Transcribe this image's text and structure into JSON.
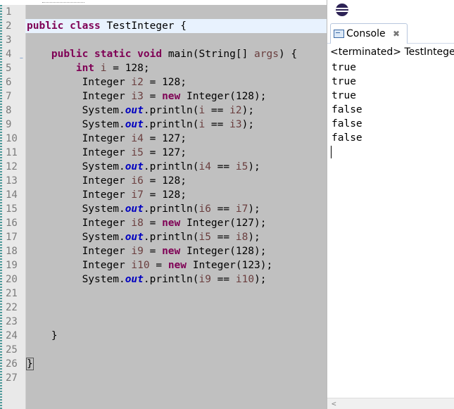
{
  "editor": {
    "lines": [
      {
        "n": "1",
        "tokens": []
      },
      {
        "n": "2",
        "tokens": [
          [
            "kw",
            "public"
          ],
          [
            "t",
            " "
          ],
          [
            "kw",
            "class"
          ],
          [
            "t",
            " TestInteger {"
          ]
        ],
        "highlight": true
      },
      {
        "n": "3",
        "tokens": []
      },
      {
        "n": "4",
        "tokens": [
          [
            "t",
            "    "
          ],
          [
            "kw",
            "public"
          ],
          [
            "t",
            " "
          ],
          [
            "kw",
            "static"
          ],
          [
            "t",
            " "
          ],
          [
            "kw",
            "void"
          ],
          [
            "t",
            " main(String[] "
          ],
          [
            "var",
            "args"
          ],
          [
            "t",
            ") {"
          ]
        ],
        "fold": true
      },
      {
        "n": "5",
        "tokens": [
          [
            "t",
            "        "
          ],
          [
            "kw",
            "int"
          ],
          [
            "t",
            " "
          ],
          [
            "var",
            "i"
          ],
          [
            "t",
            " = 128;"
          ]
        ]
      },
      {
        "n": "6",
        "tokens": [
          [
            "t",
            "         Integer "
          ],
          [
            "var",
            "i2"
          ],
          [
            "t",
            " = 128;"
          ]
        ]
      },
      {
        "n": "7",
        "tokens": [
          [
            "t",
            "         Integer "
          ],
          [
            "var",
            "i3"
          ],
          [
            "t",
            " = "
          ],
          [
            "kw",
            "new"
          ],
          [
            "t",
            " Integer(128);"
          ]
        ]
      },
      {
        "n": "8",
        "tokens": [
          [
            "t",
            "         System."
          ],
          [
            "fld",
            "out"
          ],
          [
            "t",
            ".println("
          ],
          [
            "var",
            "i"
          ],
          [
            "t",
            " == "
          ],
          [
            "var",
            "i2"
          ],
          [
            "t",
            ");"
          ]
        ]
      },
      {
        "n": "9",
        "tokens": [
          [
            "t",
            "         System."
          ],
          [
            "fld",
            "out"
          ],
          [
            "t",
            ".println("
          ],
          [
            "var",
            "i"
          ],
          [
            "t",
            " == "
          ],
          [
            "var",
            "i3"
          ],
          [
            "t",
            ");"
          ]
        ]
      },
      {
        "n": "10",
        "tokens": [
          [
            "t",
            "         Integer "
          ],
          [
            "var",
            "i4"
          ],
          [
            "t",
            " = 127;"
          ]
        ]
      },
      {
        "n": "11",
        "tokens": [
          [
            "t",
            "         Integer "
          ],
          [
            "var",
            "i5"
          ],
          [
            "t",
            " = 127;"
          ]
        ]
      },
      {
        "n": "12",
        "tokens": [
          [
            "t",
            "         System."
          ],
          [
            "fld",
            "out"
          ],
          [
            "t",
            ".println("
          ],
          [
            "var",
            "i4"
          ],
          [
            "t",
            " == "
          ],
          [
            "var",
            "i5"
          ],
          [
            "t",
            ");"
          ]
        ]
      },
      {
        "n": "13",
        "tokens": [
          [
            "t",
            "         Integer "
          ],
          [
            "var",
            "i6"
          ],
          [
            "t",
            " = 128;"
          ]
        ]
      },
      {
        "n": "14",
        "tokens": [
          [
            "t",
            "         Integer "
          ],
          [
            "var",
            "i7"
          ],
          [
            "t",
            " = 128;"
          ]
        ]
      },
      {
        "n": "15",
        "tokens": [
          [
            "t",
            "         System."
          ],
          [
            "fld",
            "out"
          ],
          [
            "t",
            ".println("
          ],
          [
            "var",
            "i6"
          ],
          [
            "t",
            " == "
          ],
          [
            "var",
            "i7"
          ],
          [
            "t",
            ");"
          ]
        ]
      },
      {
        "n": "16",
        "tokens": [
          [
            "t",
            "         Integer "
          ],
          [
            "var",
            "i8"
          ],
          [
            "t",
            " = "
          ],
          [
            "kw",
            "new"
          ],
          [
            "t",
            " Integer(127);"
          ]
        ]
      },
      {
        "n": "17",
        "tokens": [
          [
            "t",
            "         System."
          ],
          [
            "fld",
            "out"
          ],
          [
            "t",
            ".println("
          ],
          [
            "var",
            "i5"
          ],
          [
            "t",
            " == "
          ],
          [
            "var",
            "i8"
          ],
          [
            "t",
            ");"
          ]
        ]
      },
      {
        "n": "18",
        "tokens": [
          [
            "t",
            "         Integer "
          ],
          [
            "var",
            "i9"
          ],
          [
            "t",
            " = "
          ],
          [
            "kw",
            "new"
          ],
          [
            "t",
            " Integer(128);"
          ]
        ]
      },
      {
        "n": "19",
        "tokens": [
          [
            "t",
            "         Integer "
          ],
          [
            "var",
            "i10"
          ],
          [
            "t",
            " = "
          ],
          [
            "kw",
            "new"
          ],
          [
            "t",
            " Integer(123);"
          ]
        ]
      },
      {
        "n": "20",
        "tokens": [
          [
            "t",
            "         System."
          ],
          [
            "fld",
            "out"
          ],
          [
            "t",
            ".println("
          ],
          [
            "var",
            "i9"
          ],
          [
            "t",
            " == "
          ],
          [
            "var",
            "i10"
          ],
          [
            "t",
            ");"
          ]
        ]
      },
      {
        "n": "21",
        "tokens": []
      },
      {
        "n": "22",
        "tokens": []
      },
      {
        "n": "23",
        "tokens": []
      },
      {
        "n": "24",
        "tokens": [
          [
            "t",
            "    }"
          ]
        ]
      },
      {
        "n": "25",
        "tokens": []
      },
      {
        "n": "26",
        "tokens": [
          [
            "box",
            "}"
          ]
        ]
      },
      {
        "n": "27",
        "tokens": []
      }
    ]
  },
  "console": {
    "tab_label": "Console",
    "close_glyph": "✖",
    "status": "<terminated> TestInteger",
    "output": [
      "true",
      "true",
      "true",
      "false",
      "false",
      "false"
    ],
    "scroll_left_glyph": "<"
  }
}
